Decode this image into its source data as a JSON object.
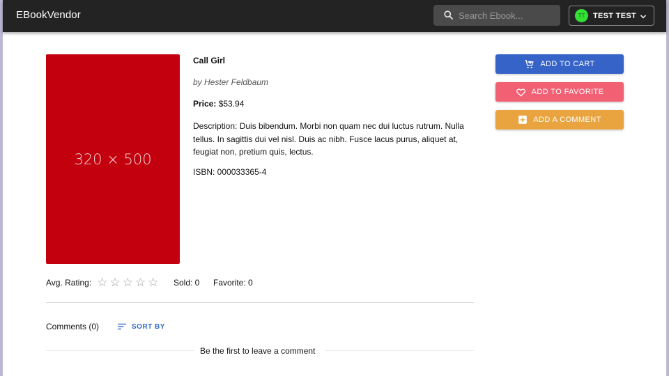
{
  "app": {
    "brand": "EBookVendor"
  },
  "search": {
    "placeholder": "Search Ebook..."
  },
  "user": {
    "initials": "TT",
    "name": "TEST TEST"
  },
  "book": {
    "cover_text": "320 × 500",
    "title": "Call Girl",
    "author": "by Hester Feldbaum",
    "price_label": "Price:",
    "price": "$53.94",
    "description": "Description: Duis bibendum. Morbi non quam nec dui luctus rutrum. Nulla tellus. In sagittis dui vel nisl. Duis ac nibh. Fusce lacus purus, aliquet at, feugiat non, pretium quis, lectus.",
    "isbn": "ISBN: 000033365-4"
  },
  "actions": {
    "cart_label": "ADD TO CART",
    "favorite_label": "ADD TO FAVORITE",
    "comment_label": "ADD A COMMENT"
  },
  "stats": {
    "rating_label": "Avg. Rating:",
    "rating_value": 0,
    "rating_max": 5,
    "sold": "Sold: 0",
    "favorite": "Favorite: 0"
  },
  "comments": {
    "label": "Comments (0)",
    "sort_label": "SORT BY",
    "empty_text": "Be the first to leave a comment"
  },
  "colors": {
    "cart": "#3563c8",
    "favorite": "#f26074",
    "comment": "#e9a43f",
    "cover": "#c3000e",
    "topbar": "#232323",
    "sort": "#2f6ac2"
  },
  "icons": {
    "search": "search-icon",
    "chevron": "chevron-down-icon",
    "cart": "cart-add-icon",
    "heart": "heart-outline-icon",
    "comment": "add-box-icon",
    "sort": "sort-icon",
    "star": "star-outline-icon"
  }
}
